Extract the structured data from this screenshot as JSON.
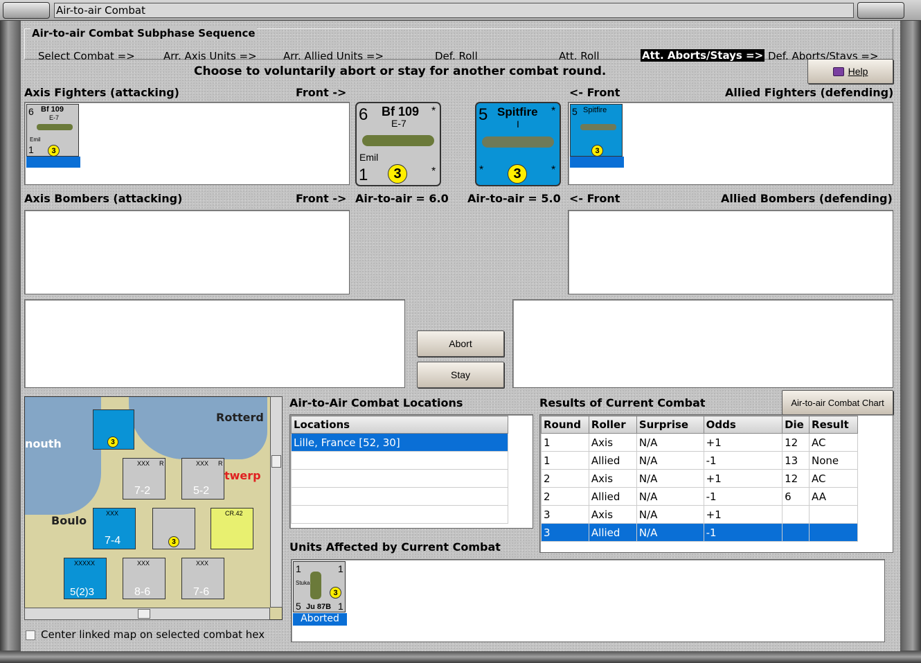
{
  "window": {
    "title": "Air-to-air Combat"
  },
  "sequence": {
    "legend": "Air-to-air Combat Subphase Sequence",
    "steps": [
      "Select Combat =>",
      "Arr. Axis Units =>",
      "Arr. Allied Units =>",
      "Def. Roll",
      "Att. Roll",
      "Att. Aborts/Stays =>",
      "Def. Aborts/Stays =>"
    ],
    "active_step": "Att. Aborts/Stays =>"
  },
  "instruction": "Choose to voluntarily abort or stay for another combat round.",
  "help_button": "Help",
  "axis_fighters": {
    "label": "Axis Fighters (attacking)",
    "front": "Front ->",
    "unit": {
      "name": "Bf 109",
      "variant": "E-7",
      "nick": "Emil",
      "left_top": "6",
      "left_bottom": "1",
      "die": "3"
    }
  },
  "allied_fighters": {
    "label": "Allied Fighters (defending)",
    "front": "<- Front",
    "unit": {
      "name": "Spitfire",
      "variant": "I",
      "left_top": "5",
      "die": "3"
    }
  },
  "axis_bombers": {
    "label": "Axis Bombers (attacking)",
    "front": "Front ->"
  },
  "allied_bombers": {
    "label": "Allied Bombers (defending)",
    "front": "<- Front"
  },
  "big_axis_counter": {
    "strength": "6",
    "name": "Bf 109",
    "variant": "E-7",
    "nick": "Emil",
    "bottom": "1",
    "die": "3",
    "star": "*"
  },
  "big_allied_counter": {
    "strength": "5",
    "name": "Spitfire",
    "variant": "I",
    "die": "3",
    "star": "*"
  },
  "air_to_air": {
    "axis": "Air-to-air = 6.0",
    "allied": "Air-to-air = 5.0"
  },
  "buttons": {
    "abort": "Abort",
    "stay": "Stay",
    "chart": "Air-to-air Combat Chart"
  },
  "locations": {
    "title": "Air-to-Air Combat Locations",
    "header": "Locations",
    "rows": [
      "Lille, France [52, 30]",
      "",
      "",
      "",
      ""
    ]
  },
  "results": {
    "title": "Results of Current Combat",
    "headers": [
      "Round",
      "Roller",
      "Surprise",
      "Odds",
      "Die",
      "Result"
    ],
    "rows": [
      [
        "1",
        "Axis",
        "N/A",
        "+1",
        "12",
        "AC"
      ],
      [
        "1",
        "Allied",
        "N/A",
        "-1",
        "13",
        "None"
      ],
      [
        "2",
        "Axis",
        "N/A",
        "+1",
        "12",
        "AC"
      ],
      [
        "2",
        "Allied",
        "N/A",
        "-1",
        "6",
        "AA"
      ],
      [
        "3",
        "Axis",
        "N/A",
        "+1",
        "",
        ""
      ],
      [
        "3",
        "Allied",
        "N/A",
        "-1",
        "",
        ""
      ]
    ],
    "selected_row": 5
  },
  "units_affected": {
    "title": "Units Affected by Current Combat",
    "unit": {
      "top_left": "1",
      "top_right": "1",
      "name": "Ju 87B",
      "code": "Stuka",
      "bottom_left": "5",
      "bottom_right": "1",
      "die": "3",
      "status": "Aborted"
    }
  },
  "map": {
    "labels": [
      "Rotterd",
      "nouth",
      "twerp",
      "Boulo"
    ],
    "counters": [
      {
        "top": "XXX",
        "val": "7-2",
        "side": "R"
      },
      {
        "top": "XXX",
        "val": "5-2",
        "side": "R"
      },
      {
        "top": "XXX",
        "val": "7-4"
      },
      {
        "top": "XXXXX",
        "val": "5(2)3"
      },
      {
        "top": "XXX",
        "val": "8-6"
      },
      {
        "top": "XXX",
        "val": "7-6"
      },
      {
        "top": "4",
        "val": "CR.42"
      }
    ]
  },
  "center_checkbox": "Center linked map on selected combat hex",
  "colors": {
    "allied_blue": "#0a93d6",
    "select_blue": "#0a6fd6",
    "die_yellow": "#ffee00",
    "axis_grey": "#c8c8c8"
  }
}
